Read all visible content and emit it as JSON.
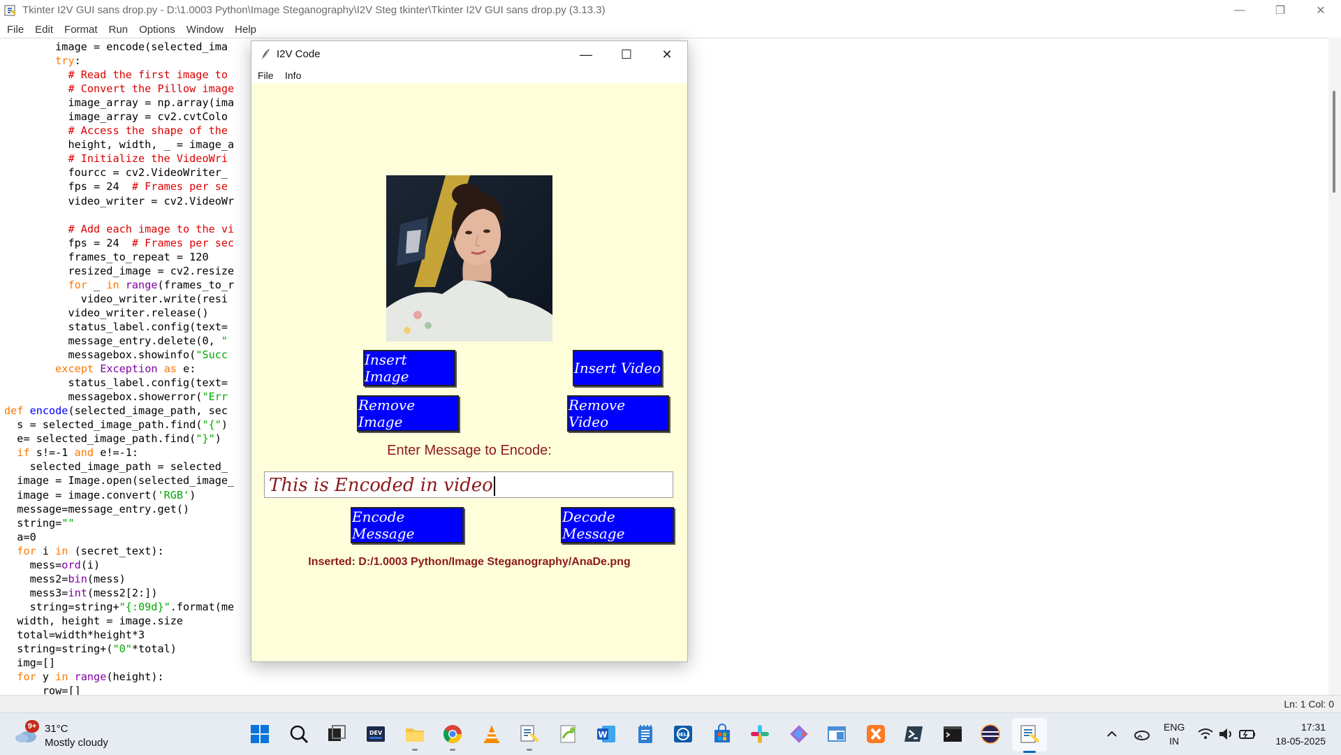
{
  "idle": {
    "title": "Tkinter I2V GUI sans drop.py - D:\\1.0003 Python\\Image Steganography\\I2V Steg tkinter\\Tkinter I2V GUI sans drop.py (3.13.3)",
    "menu": [
      "File",
      "Edit",
      "Format",
      "Run",
      "Options",
      "Window",
      "Help"
    ],
    "status": "Ln: 1   Col: 0",
    "code": [
      {
        "indent": "        ",
        "parts": [
          [
            "",
            "image = encode(selected_ima"
          ]
        ]
      },
      {
        "indent": "        ",
        "parts": [
          [
            "kw",
            "try"
          ],
          [
            "",
            ":"
          ]
        ]
      },
      {
        "indent": "          ",
        "parts": [
          [
            "cm",
            "# Read the first image to"
          ]
        ]
      },
      {
        "indent": "          ",
        "parts": [
          [
            "cm",
            "# Convert the Pillow image"
          ]
        ]
      },
      {
        "indent": "          ",
        "parts": [
          [
            "",
            "image_array = np.array(ima"
          ]
        ]
      },
      {
        "indent": "          ",
        "parts": [
          [
            "",
            "image_array = cv2.cvtColo"
          ]
        ]
      },
      {
        "indent": "          ",
        "parts": [
          [
            "cm",
            "# Access the shape of the"
          ]
        ]
      },
      {
        "indent": "          ",
        "parts": [
          [
            "",
            "height, width, _ = image_a"
          ]
        ]
      },
      {
        "indent": "          ",
        "parts": [
          [
            "cm",
            "# Initialize the VideoWri"
          ]
        ]
      },
      {
        "indent": "          ",
        "parts": [
          [
            "",
            "fourcc = cv2.VideoWriter_"
          ]
        ]
      },
      {
        "indent": "          ",
        "parts": [
          [
            "",
            "fps = 24  "
          ],
          [
            "cm",
            "# Frames per se"
          ]
        ]
      },
      {
        "indent": "          ",
        "parts": [
          [
            "",
            "video_writer = cv2.VideoWr"
          ]
        ]
      },
      {
        "indent": "",
        "parts": [
          [
            "",
            ""
          ]
        ]
      },
      {
        "indent": "          ",
        "parts": [
          [
            "cm",
            "# Add each image to the vi"
          ]
        ]
      },
      {
        "indent": "          ",
        "parts": [
          [
            "",
            "fps = 24  "
          ],
          [
            "cm",
            "# Frames per sec"
          ]
        ]
      },
      {
        "indent": "          ",
        "parts": [
          [
            "",
            "frames_to_repeat = 120"
          ]
        ]
      },
      {
        "indent": "          ",
        "parts": [
          [
            "",
            "resized_image = cv2.resize"
          ]
        ]
      },
      {
        "indent": "          ",
        "parts": [
          [
            "kw",
            "for"
          ],
          [
            "",
            " _ "
          ],
          [
            "kw",
            "in"
          ],
          [
            "",
            " "
          ],
          [
            "kw2",
            "range"
          ],
          [
            "",
            "(frames_to_r"
          ]
        ]
      },
      {
        "indent": "            ",
        "parts": [
          [
            "",
            "video_writer.write(resi"
          ]
        ]
      },
      {
        "indent": "          ",
        "parts": [
          [
            "",
            "video_writer.release()"
          ]
        ]
      },
      {
        "indent": "          ",
        "parts": [
          [
            "",
            "status_label.config(text="
          ]
        ]
      },
      {
        "indent": "          ",
        "parts": [
          [
            "",
            "message_entry.delete(0, "
          ],
          [
            "st",
            "\""
          ]
        ]
      },
      {
        "indent": "          ",
        "parts": [
          [
            "",
            "messagebox.showinfo("
          ],
          [
            "st",
            "\"Succ"
          ]
        ]
      },
      {
        "indent": "        ",
        "parts": [
          [
            "kw",
            "except"
          ],
          [
            "",
            " "
          ],
          [
            "kw2",
            "Exception"
          ],
          [
            "",
            " "
          ],
          [
            "kw",
            "as"
          ],
          [
            "",
            " e:"
          ]
        ]
      },
      {
        "indent": "          ",
        "parts": [
          [
            "",
            "status_label.config(text="
          ]
        ]
      },
      {
        "indent": "          ",
        "parts": [
          [
            "",
            "messagebox.showerror("
          ],
          [
            "st",
            "\"Err"
          ]
        ]
      },
      {
        "indent": "",
        "parts": [
          [
            "kw",
            "def"
          ],
          [
            "",
            " "
          ],
          [
            "df",
            "encode"
          ],
          [
            "",
            "(selected_image_path, sec"
          ]
        ]
      },
      {
        "indent": "  ",
        "parts": [
          [
            "",
            "s = selected_image_path.find("
          ],
          [
            "st",
            "\"{\""
          ],
          [
            "",
            ")"
          ]
        ]
      },
      {
        "indent": "  ",
        "parts": [
          [
            "",
            "e= selected_image_path.find("
          ],
          [
            "st",
            "\"}\""
          ],
          [
            "",
            ")"
          ]
        ]
      },
      {
        "indent": "  ",
        "parts": [
          [
            "kw",
            "if"
          ],
          [
            "",
            " s!=-1 "
          ],
          [
            "kw",
            "and"
          ],
          [
            "",
            " e!=-1:"
          ]
        ]
      },
      {
        "indent": "    ",
        "parts": [
          [
            "",
            "selected_image_path = selected_"
          ]
        ]
      },
      {
        "indent": "  ",
        "parts": [
          [
            "",
            "image = Image.open(selected_image_"
          ]
        ]
      },
      {
        "indent": "  ",
        "parts": [
          [
            "",
            "image = image.convert("
          ],
          [
            "st",
            "'RGB'"
          ],
          [
            "",
            ")"
          ]
        ]
      },
      {
        "indent": "  ",
        "parts": [
          [
            "",
            "message=message_entry.get()"
          ]
        ]
      },
      {
        "indent": "  ",
        "parts": [
          [
            "",
            "string="
          ],
          [
            "st",
            "\"\""
          ]
        ]
      },
      {
        "indent": "  ",
        "parts": [
          [
            "",
            "a=0"
          ]
        ]
      },
      {
        "indent": "  ",
        "parts": [
          [
            "kw",
            "for"
          ],
          [
            "",
            " i "
          ],
          [
            "kw",
            "in"
          ],
          [
            "",
            " (secret_text):"
          ]
        ]
      },
      {
        "indent": "    ",
        "parts": [
          [
            "",
            "mess="
          ],
          [
            "kw2",
            "ord"
          ],
          [
            "",
            "(i)"
          ]
        ]
      },
      {
        "indent": "    ",
        "parts": [
          [
            "",
            "mess2="
          ],
          [
            "kw2",
            "bin"
          ],
          [
            "",
            "(mess)"
          ]
        ]
      },
      {
        "indent": "    ",
        "parts": [
          [
            "",
            "mess3="
          ],
          [
            "kw2",
            "int"
          ],
          [
            "",
            "(mess2[2:])"
          ]
        ]
      },
      {
        "indent": "    ",
        "parts": [
          [
            "",
            "string=string+"
          ],
          [
            "st",
            "\"{:09d}\""
          ],
          [
            "",
            ".format(me"
          ]
        ]
      },
      {
        "indent": "  ",
        "parts": [
          [
            "",
            "width, height = image.size"
          ]
        ]
      },
      {
        "indent": "  ",
        "parts": [
          [
            "",
            "total=width*height*3"
          ]
        ]
      },
      {
        "indent": "  ",
        "parts": [
          [
            "",
            "string=string+("
          ],
          [
            "st",
            "\"0\""
          ],
          [
            "",
            "*total)"
          ]
        ]
      },
      {
        "indent": "  ",
        "parts": [
          [
            "",
            "img=[]"
          ]
        ]
      },
      {
        "indent": "  ",
        "parts": [
          [
            "kw",
            "for"
          ],
          [
            "",
            " y "
          ],
          [
            "kw",
            "in"
          ],
          [
            "",
            " "
          ],
          [
            "kw2",
            "range"
          ],
          [
            "",
            "(height):"
          ]
        ]
      },
      {
        "indent": "      ",
        "parts": [
          [
            "",
            "row=[]"
          ]
        ]
      }
    ]
  },
  "i2v": {
    "title": "I2V Code",
    "menu": [
      "File",
      "Info"
    ],
    "buttons": {
      "insert_image": "Insert Image",
      "insert_video": "Insert Video",
      "remove_image": "Remove Image",
      "remove_video": "Remove Video",
      "encode": "Encode Message",
      "decode": "Decode Message"
    },
    "enter_label": "Enter Message to Encode:",
    "message_value": "This is Encoded in video",
    "status": "Inserted: D:/1.0003 Python/Image Steganography/AnaDe.png",
    "image_desc": "portrait-photo"
  },
  "taskbar": {
    "weather_badge": "9+",
    "weather_temp": "31°C",
    "weather_desc": "Mostly cloudy",
    "apps": [
      "start-icon",
      "search-icon",
      "task-view-icon",
      "dev-home-icon",
      "file-explorer-icon",
      "chrome-icon",
      "vlc-icon",
      "python-icon",
      "notepad-plus-icon",
      "word-icon",
      "notepad-icon",
      "dell-icon",
      "store-icon",
      "slack-icon",
      "git-icon",
      "window-icon",
      "xampp-icon",
      "powershell-icon",
      "terminal-icon",
      "eclipse-icon",
      "idle-icon"
    ],
    "lang": "ENG",
    "region": "IN",
    "time": "17:31",
    "date": "18-05-2025"
  },
  "colors": {
    "button_blue": "#0000ff",
    "window_bg": "#fffedb",
    "label_red": "#8b1a1a"
  }
}
